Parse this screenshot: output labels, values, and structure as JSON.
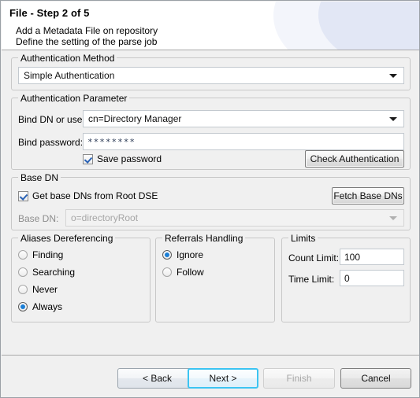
{
  "header": {
    "title": "File - Step 2 of 5",
    "subtitle_line1": "Add a Metadata File on repository",
    "subtitle_line2": "Define the setting of the parse job"
  },
  "auth_method": {
    "legend": "Authentication Method",
    "selected": "Simple Authentication"
  },
  "auth_parameter": {
    "legend": "Authentication Parameter",
    "bind_dn_label": "Bind DN or user:",
    "bind_dn_value": "cn=Directory Manager",
    "bind_password_label": "Bind password:",
    "bind_password_value": "********",
    "save_password_label": "Save password",
    "save_password_checked": true,
    "check_auth_button": "Check Authentication"
  },
  "base_dn": {
    "legend": "Base DN",
    "get_base_dns_label": "Get base DNs from Root DSE",
    "get_base_dns_checked": true,
    "fetch_button": "Fetch Base DNs",
    "base_dn_label": "Base DN:",
    "base_dn_value": "o=directoryRoot",
    "base_dn_disabled": true
  },
  "aliases": {
    "legend": "Aliases Dereferencing",
    "options": [
      {
        "label": "Finding",
        "selected": false
      },
      {
        "label": "Searching",
        "selected": false
      },
      {
        "label": "Never",
        "selected": false
      },
      {
        "label": "Always",
        "selected": true
      }
    ]
  },
  "referrals": {
    "legend": "Referrals Handling",
    "options": [
      {
        "label": "Ignore",
        "selected": true
      },
      {
        "label": "Follow",
        "selected": false
      }
    ]
  },
  "limits": {
    "legend": "Limits",
    "count_limit_label": "Count Limit:",
    "count_limit_value": "100",
    "time_limit_label": "Time Limit:",
    "time_limit_value": "0"
  },
  "footer": {
    "back": "< Back",
    "next": "Next >",
    "finish": "Finish",
    "cancel": "Cancel"
  },
  "colors": {
    "window_bg": "#f0f0f0",
    "accent_focus": "#3cc4f2",
    "radio_dot": "#1c7fd6",
    "check_mark": "#2a62b5",
    "banner_arc_light": "#f3f5fb",
    "banner_arc_dark": "#e2e7f5"
  }
}
